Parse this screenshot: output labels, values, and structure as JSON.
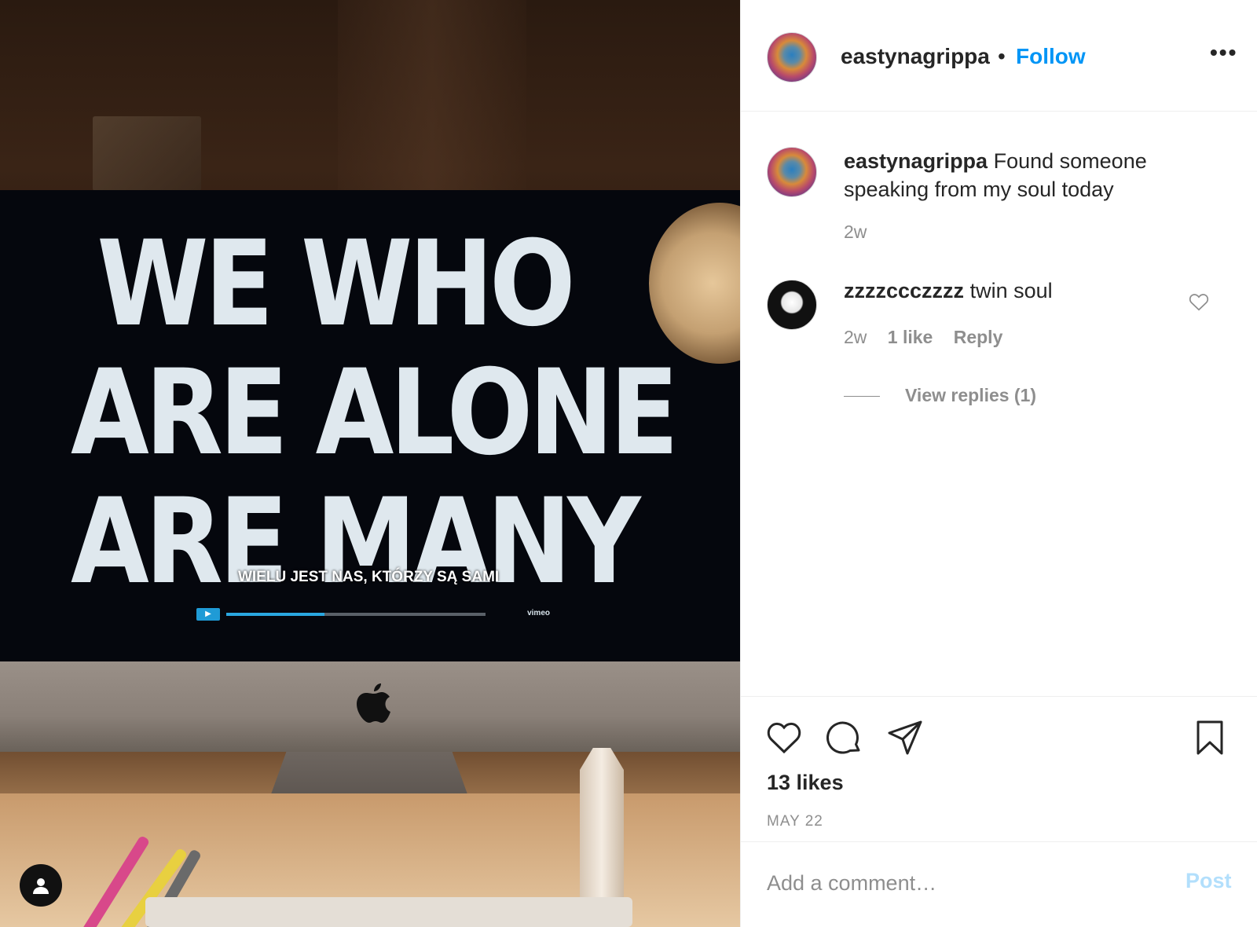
{
  "photo": {
    "screen_text_lines": [
      "WE WHO",
      "ARE ALONE",
      "ARE MANY"
    ],
    "subtitle": "WIELU JEST NAS, KTÓRZY SĄ SAMI",
    "video_progress": 0.38,
    "player_brand": "vimeo"
  },
  "header": {
    "username": "eastynagrippa",
    "separator": "•",
    "follow_label": "Follow",
    "more_label": "•••"
  },
  "caption": {
    "username": "eastynagrippa",
    "text": "Found someone speaking from my soul today",
    "time": "2w"
  },
  "comments": [
    {
      "username": "zzzzccczzzz",
      "text": "twin soul",
      "time": "2w",
      "likes": "1 like",
      "reply_label": "Reply",
      "view_replies": "View replies (1)"
    }
  ],
  "actions": {
    "icons": [
      "heart-icon",
      "comment-icon",
      "share-icon",
      "bookmark-icon"
    ],
    "likes": "13 likes",
    "date": "MAY 22"
  },
  "comment_box": {
    "placeholder": "Add a comment…",
    "post_label": "Post"
  },
  "colors": {
    "accent": "#0095f6",
    "post_disabled": "#b2dffc",
    "muted": "#8e8e8e",
    "text": "#262626"
  }
}
